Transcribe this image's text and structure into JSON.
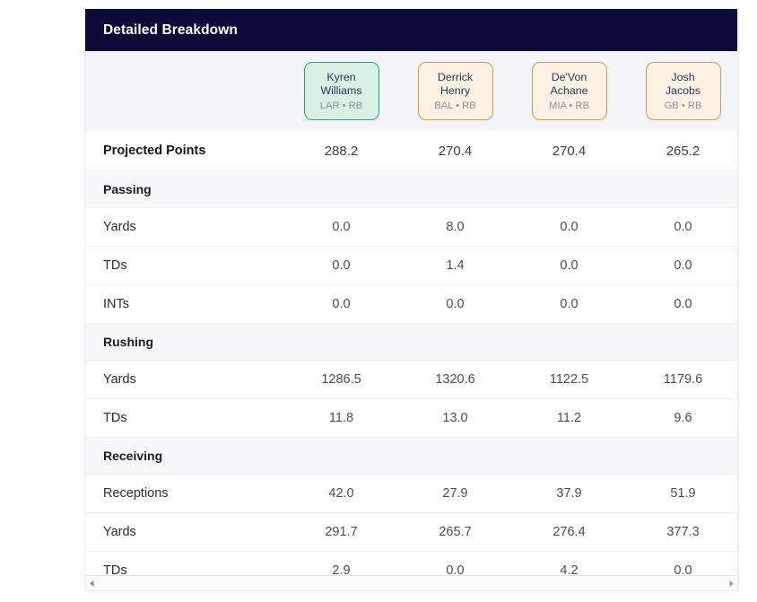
{
  "panel": {
    "title": "Detailed Breakdown"
  },
  "players": [
    {
      "first_name": "Kyren",
      "last_name": "Williams",
      "meta": "LAR • RB",
      "accent": "#2f9e74",
      "background": "#d9f0e5",
      "highlight": true
    },
    {
      "first_name": "Derrick",
      "last_name": "Henry",
      "meta": "BAL • RB",
      "accent": "#d59a52",
      "background": "#fdf2e3",
      "highlight": false
    },
    {
      "first_name": "De'Von",
      "last_name": "Achane",
      "meta": "MIA • RB",
      "accent": "#d59a52",
      "background": "#fdf2e3",
      "highlight": false
    },
    {
      "first_name": "Josh",
      "last_name": "Jacobs",
      "meta": "GB • RB",
      "accent": "#d59a52",
      "background": "#fdf2e3",
      "highlight": false
    }
  ],
  "rows": [
    {
      "kind": "stat",
      "label": "Projected Points",
      "emphasis": true,
      "values": [
        "288.2",
        "270.4",
        "270.4",
        "265.2"
      ]
    },
    {
      "kind": "section",
      "label": "Passing"
    },
    {
      "kind": "stat",
      "label": "Yards",
      "emphasis": false,
      "values": [
        "0.0",
        "8.0",
        "0.0",
        "0.0"
      ]
    },
    {
      "kind": "stat",
      "label": "TDs",
      "emphasis": false,
      "values": [
        "0.0",
        "1.4",
        "0.0",
        "0.0"
      ]
    },
    {
      "kind": "stat",
      "label": "INTs",
      "emphasis": false,
      "values": [
        "0.0",
        "0.0",
        "0.0",
        "0.0"
      ]
    },
    {
      "kind": "section",
      "label": "Rushing"
    },
    {
      "kind": "stat",
      "label": "Yards",
      "emphasis": false,
      "values": [
        "1286.5",
        "1320.6",
        "1122.5",
        "1179.6"
      ]
    },
    {
      "kind": "stat",
      "label": "TDs",
      "emphasis": false,
      "values": [
        "11.8",
        "13.0",
        "11.2",
        "9.6"
      ]
    },
    {
      "kind": "section",
      "label": "Receiving"
    },
    {
      "kind": "stat",
      "label": "Receptions",
      "emphasis": false,
      "values": [
        "42.0",
        "27.9",
        "37.9",
        "51.9"
      ]
    },
    {
      "kind": "stat",
      "label": "Yards",
      "emphasis": false,
      "values": [
        "291.7",
        "265.7",
        "276.4",
        "377.3"
      ]
    },
    {
      "kind": "stat",
      "label": "TDs",
      "emphasis": false,
      "values": [
        "2.9",
        "0.0",
        "4.2",
        "0.0"
      ]
    }
  ],
  "scrollbar": {
    "left_arrow_icon": "triangle-left-icon",
    "right_arrow_icon": "triangle-right-icon"
  },
  "colors": {
    "header_bar": "#0c0a38",
    "header_text": "#ffffff",
    "section_row": "#f7f8fa",
    "player_row": "#f4f5f9",
    "highlight_accent": "#2f9e74",
    "normal_accent": "#d59a52"
  }
}
